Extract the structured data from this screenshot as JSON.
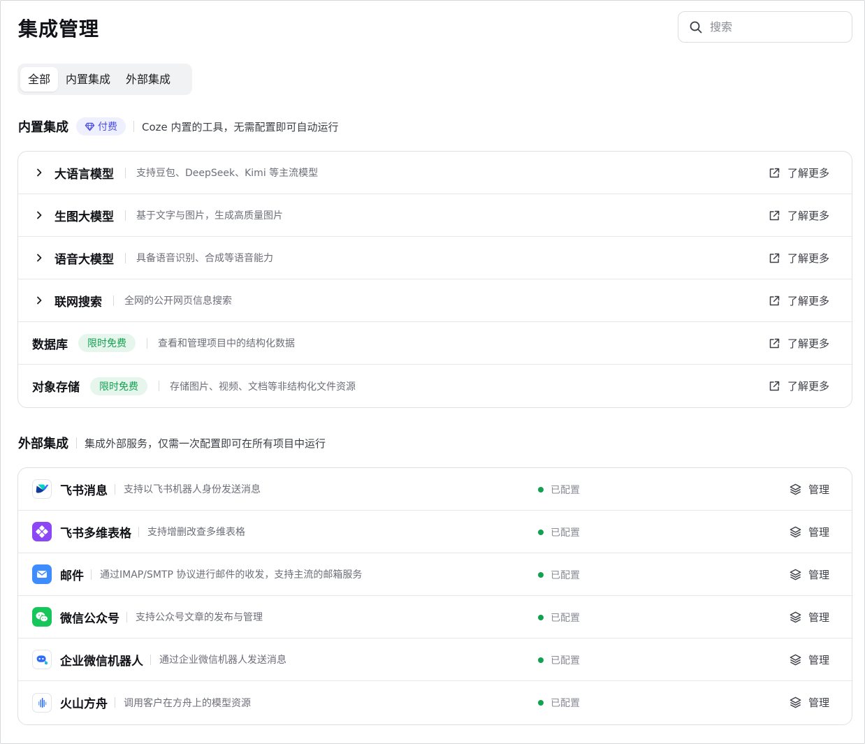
{
  "page": {
    "title": "集成管理"
  },
  "search": {
    "placeholder": "搜索"
  },
  "tabs": [
    {
      "label": "全部",
      "active": true
    },
    {
      "label": "内置集成",
      "active": false
    },
    {
      "label": "外部集成",
      "active": false
    }
  ],
  "builtin": {
    "title": "内置集成",
    "badge": "付费",
    "description": "Coze 内置的工具，无需配置即可自动运行",
    "items": [
      {
        "name": "大语言模型",
        "description": "支持豆包、DeepSeek、Kimi 等主流模型",
        "expandable": true,
        "badge": "",
        "action": "了解更多"
      },
      {
        "name": "生图大模型",
        "description": "基于文字与图片，生成高质量图片",
        "expandable": true,
        "badge": "",
        "action": "了解更多"
      },
      {
        "name": "语音大模型",
        "description": "具备语音识别、合成等语音能力",
        "expandable": true,
        "badge": "",
        "action": "了解更多"
      },
      {
        "name": "联网搜索",
        "description": "全网的公开网页信息搜索",
        "expandable": true,
        "badge": "",
        "action": "了解更多"
      },
      {
        "name": "数据库",
        "description": "查看和管理项目中的结构化数据",
        "expandable": false,
        "badge": "限时免费",
        "action": "了解更多"
      },
      {
        "name": "对象存储",
        "description": "存储图片、视频、文档等非结构化文件资源",
        "expandable": false,
        "badge": "限时免费",
        "action": "了解更多"
      }
    ]
  },
  "external": {
    "title": "外部集成",
    "description": "集成外部服务，仅需一次配置即可在所有项目中运行",
    "items": [
      {
        "name": "飞书消息",
        "description": "支持以飞书机器人身份发送消息",
        "icon": "feishu-icon",
        "status": "已配置",
        "action": "管理"
      },
      {
        "name": "飞书多维表格",
        "description": "支持增删改查多维表格",
        "icon": "feishu-bitable-icon",
        "status": "已配置",
        "action": "管理"
      },
      {
        "name": "邮件",
        "description": "通过IMAP/SMTP 协议进行邮件的收发，支持主流的邮箱服务",
        "icon": "mail-icon",
        "status": "已配置",
        "action": "管理"
      },
      {
        "name": "微信公众号",
        "description": "支持公众号文章的发布与管理",
        "icon": "wechat-icon",
        "status": "已配置",
        "action": "管理"
      },
      {
        "name": "企业微信机器人",
        "description": "通过企业微信机器人发送消息",
        "icon": "wecom-bot-icon",
        "status": "已配置",
        "action": "管理"
      },
      {
        "name": "火山方舟",
        "description": "调用客户在方舟上的模型资源",
        "icon": "volcengine-ark-icon",
        "status": "已配置",
        "action": "管理"
      }
    ]
  },
  "colors": {
    "accent": "#4b4fe0",
    "free_green": "#12a150",
    "status_dot": "#12a150"
  }
}
